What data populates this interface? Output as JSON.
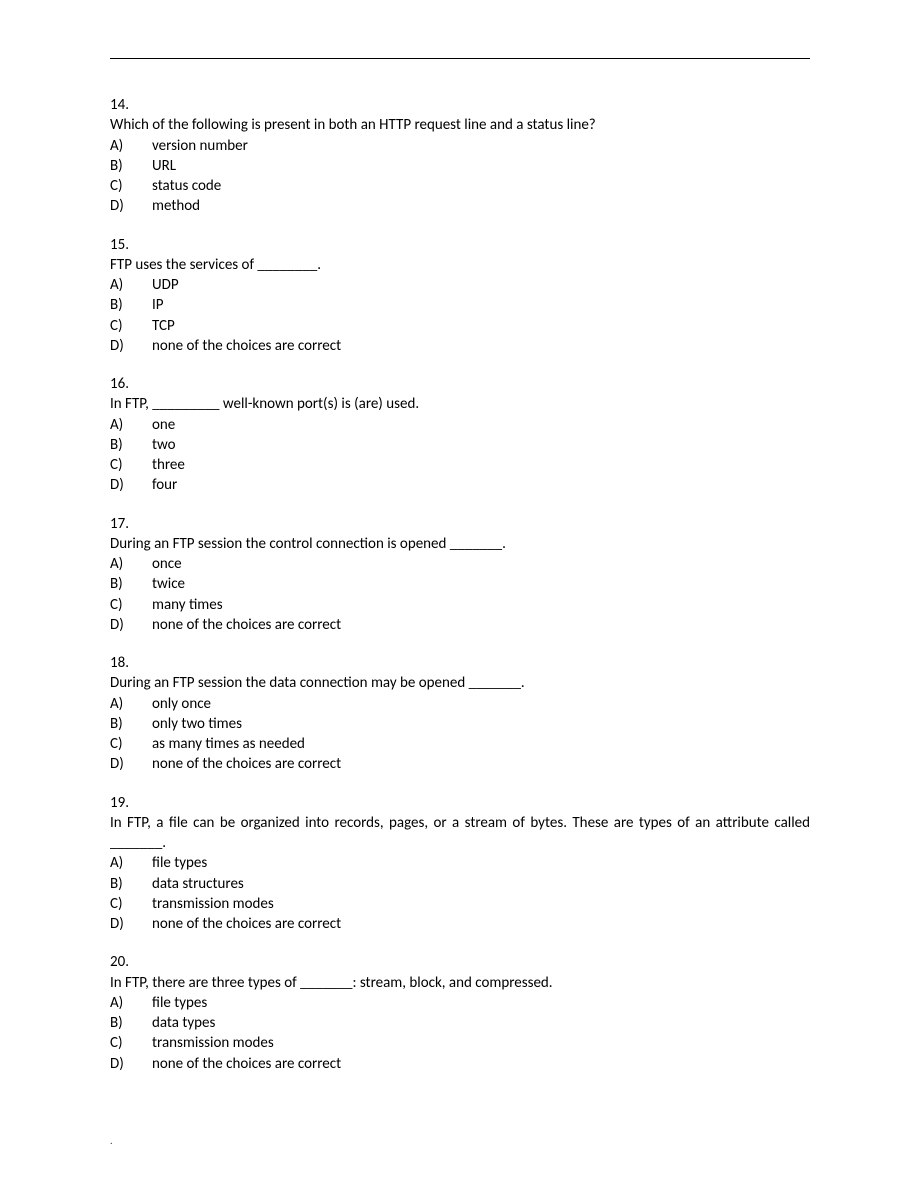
{
  "questions": [
    {
      "number": "14.",
      "text": "Which of the following is present in both an HTTP request line and a status line?",
      "options": [
        {
          "letter": "A)",
          "text": "version number"
        },
        {
          "letter": "B)",
          "text": "URL"
        },
        {
          "letter": "C)",
          "text": "status code"
        },
        {
          "letter": "D)",
          "text": "method"
        }
      ]
    },
    {
      "number": "15.",
      "text": "FTP uses the services of ________.",
      "options": [
        {
          "letter": "A)",
          "text": "UDP"
        },
        {
          "letter": "B)",
          "text": "IP"
        },
        {
          "letter": "C)",
          "text": "TCP"
        },
        {
          "letter": "D)",
          "text": "none of the choices are correct"
        }
      ]
    },
    {
      "number": "16.",
      "text": "In FTP, _________ well-known port(s) is (are) used.",
      "options": [
        {
          "letter": "A)",
          "text": "one"
        },
        {
          "letter": "B)",
          "text": "two"
        },
        {
          "letter": "C)",
          "text": "three"
        },
        {
          "letter": "D)",
          "text": "four"
        }
      ]
    },
    {
      "number": "17.",
      "text": "During an FTP session the control connection is opened _______.",
      "options": [
        {
          "letter": "A)",
          "text": "once"
        },
        {
          "letter": "B)",
          "text": "twice"
        },
        {
          "letter": "C)",
          "text": "many times"
        },
        {
          "letter": "D)",
          "text": "none of the choices are correct"
        }
      ]
    },
    {
      "number": "18.",
      "text": "During an FTP session the data connection may be opened _______.",
      "options": [
        {
          "letter": "A)",
          "text": "only once"
        },
        {
          "letter": "B)",
          "text": "only two times"
        },
        {
          "letter": "C)",
          "text": "as many times as needed"
        },
        {
          "letter": "D)",
          "text": "none of the choices are correct"
        }
      ]
    },
    {
      "number": "19.",
      "text": "In FTP, a file can be organized into records, pages, or a stream of bytes. These are types of an attribute called _______.",
      "options": [
        {
          "letter": "A)",
          "text": "file types"
        },
        {
          "letter": "B)",
          "text": "data structures"
        },
        {
          "letter": "C)",
          "text": "transmission modes"
        },
        {
          "letter": "D)",
          "text": "none of the choices are correct"
        }
      ]
    },
    {
      "number": "20.",
      "text": "In FTP, there are three types of _______: stream, block, and compressed.",
      "options": [
        {
          "letter": "A)",
          "text": "file types"
        },
        {
          "letter": "B)",
          "text": "data types"
        },
        {
          "letter": "C)",
          "text": "transmission modes"
        },
        {
          "letter": "D)",
          "text": "none of the choices are correct"
        }
      ]
    }
  ],
  "footer_dot": "."
}
